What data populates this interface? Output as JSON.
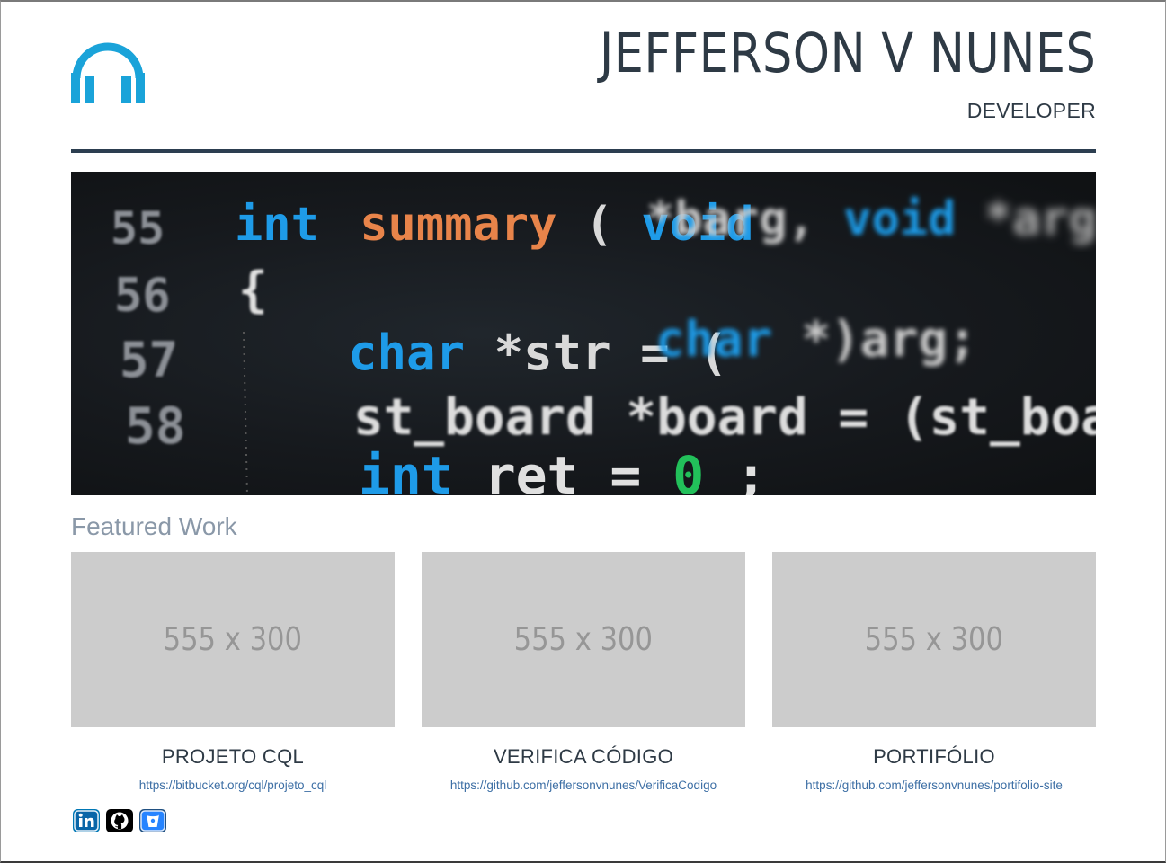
{
  "header": {
    "name": "JEFFERSON V NUNES",
    "role": "DEVELOPER",
    "logo_icon": "headphones-icon",
    "accent": "#1aa3d9"
  },
  "hero": {
    "line_numbers": [
      "55",
      "56",
      "57",
      "58"
    ],
    "code": {
      "l55_kw": "int",
      "l55_fn": "summary",
      "l55_paren": "(",
      "l55_void": "void",
      "l55_rest": " *barg,",
      "l55_void2": "void",
      "l55_rest2": " *arg)",
      "l56": "{",
      "l57_kw": "char",
      "l57_rest": " *str = (",
      "l57_kw2": "char",
      "l57_rest2": " *)arg;",
      "l58": "st_board *board = (st_board *)bo",
      "l59_kw": "int",
      "l59_rest": " ret = ",
      "l59_num": "0",
      "l59_end": ";"
    }
  },
  "featured": {
    "title": "Featured Work",
    "cards": [
      {
        "thumb": "555 x 300",
        "title": "PROJETO CQL",
        "link": "https://bitbucket.org/cql/projeto_cql"
      },
      {
        "thumb": "555 x 300",
        "title": "VERIFICA CÓDIGO",
        "link": "https://github.com/jeffersonvnunes/VerificaCodigo"
      },
      {
        "thumb": "555 x 300",
        "title": "PORTIFÓLIO",
        "link": "https://github.com/jeffersonvnunes/portifolio-site"
      }
    ]
  },
  "social": [
    {
      "icon": "linkedin-icon",
      "color": "#0077b5"
    },
    {
      "icon": "github-icon",
      "color": "#000000"
    },
    {
      "icon": "bitbucket-icon",
      "color": "#205081"
    }
  ]
}
